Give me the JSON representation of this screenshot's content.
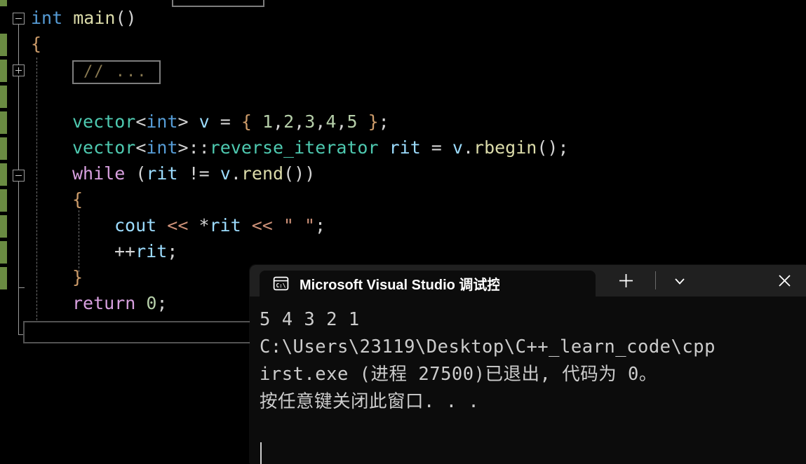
{
  "editor": {
    "name": "visual-studio-code-editor",
    "background": "#000000",
    "change_bar_color": "#6a8b42",
    "collapsed_comment_text": "// ...",
    "lines": [
      {
        "indent": 0,
        "tokens": []
      },
      {
        "indent": 0,
        "tokens": [
          {
            "t": "int",
            "c": "t-blue"
          },
          {
            "t": " ",
            "c": "t-punc"
          },
          {
            "t": "main",
            "c": "t-func"
          },
          {
            "t": "()",
            "c": "t-punc"
          }
        ]
      },
      {
        "indent": 0,
        "tokens": [
          {
            "t": "{",
            "c": "t-brace"
          }
        ]
      },
      {
        "indent": 0,
        "tokens": []
      },
      {
        "indent": 0,
        "tokens": []
      },
      {
        "indent": 0,
        "tokens": [
          {
            "t": "vector",
            "c": "t-type"
          },
          {
            "t": "<",
            "c": "t-punc"
          },
          {
            "t": "int",
            "c": "t-blue"
          },
          {
            "t": ">",
            "c": "t-punc"
          },
          {
            "t": " ",
            "c": "t-punc"
          },
          {
            "t": "v",
            "c": "t-light"
          },
          {
            "t": " = ",
            "c": "t-punc"
          },
          {
            "t": "{ ",
            "c": "t-brace"
          },
          {
            "t": "1",
            "c": "t-num"
          },
          {
            "t": ",",
            "c": "t-punc"
          },
          {
            "t": "2",
            "c": "t-num"
          },
          {
            "t": ",",
            "c": "t-punc"
          },
          {
            "t": "3",
            "c": "t-num"
          },
          {
            "t": ",",
            "c": "t-punc"
          },
          {
            "t": "4",
            "c": "t-num"
          },
          {
            "t": ",",
            "c": "t-punc"
          },
          {
            "t": "5",
            "c": "t-num"
          },
          {
            "t": " }",
            "c": "t-brace"
          },
          {
            "t": ";",
            "c": "t-punc"
          }
        ]
      },
      {
        "indent": 0,
        "tokens": [
          {
            "t": "vector",
            "c": "t-type"
          },
          {
            "t": "<",
            "c": "t-punc"
          },
          {
            "t": "int",
            "c": "t-blue"
          },
          {
            "t": ">",
            "c": "t-punc"
          },
          {
            "t": "::",
            "c": "t-punc"
          },
          {
            "t": "reverse_iterator",
            "c": "t-type"
          },
          {
            "t": " ",
            "c": "t-punc"
          },
          {
            "t": "rit",
            "c": "t-light"
          },
          {
            "t": " = ",
            "c": "t-punc"
          },
          {
            "t": "v",
            "c": "t-light"
          },
          {
            "t": ".",
            "c": "t-punc"
          },
          {
            "t": "rbegin",
            "c": "t-func"
          },
          {
            "t": "();",
            "c": "t-punc"
          }
        ]
      },
      {
        "indent": 0,
        "tokens": [
          {
            "t": "while",
            "c": "t-kw"
          },
          {
            "t": " (",
            "c": "t-punc"
          },
          {
            "t": "rit",
            "c": "t-light"
          },
          {
            "t": " != ",
            "c": "t-punc"
          },
          {
            "t": "v",
            "c": "t-light"
          },
          {
            "t": ".",
            "c": "t-punc"
          },
          {
            "t": "rend",
            "c": "t-func"
          },
          {
            "t": "())",
            "c": "t-punc"
          }
        ]
      },
      {
        "indent": 0,
        "tokens": [
          {
            "t": "{",
            "c": "t-brace"
          }
        ]
      },
      {
        "indent": 0,
        "tokens": [
          {
            "t": "cout",
            "c": "t-light"
          },
          {
            "t": " << ",
            "c": "t-str"
          },
          {
            "t": "*",
            "c": "t-punc"
          },
          {
            "t": "rit",
            "c": "t-light"
          },
          {
            "t": " << ",
            "c": "t-str"
          },
          {
            "t": "\" \"",
            "c": "t-str"
          },
          {
            "t": ";",
            "c": "t-punc"
          }
        ]
      },
      {
        "indent": 0,
        "tokens": [
          {
            "t": "++",
            "c": "t-punc"
          },
          {
            "t": "rit",
            "c": "t-light"
          },
          {
            "t": ";",
            "c": "t-punc"
          }
        ]
      },
      {
        "indent": 0,
        "tokens": [
          {
            "t": "}",
            "c": "t-brace"
          }
        ]
      },
      {
        "indent": 0,
        "tokens": [
          {
            "t": "return",
            "c": "t-kw"
          },
          {
            "t": " ",
            "c": "t-punc"
          },
          {
            "t": "0",
            "c": "t-num"
          },
          {
            "t": ";",
            "c": "t-punc"
          }
        ]
      },
      {
        "indent": 0,
        "tokens": [
          {
            "t": "}",
            "c": "t-brace"
          }
        ]
      }
    ]
  },
  "terminal": {
    "tab_title": "Microsoft Visual Studio 调试控",
    "tab_icon": "console-cmd-icon",
    "close_label": "✕",
    "newtab_label": "+",
    "dropdown_label": "⌄",
    "output": [
      "5 4 3 2 1",
      "C:\\Users\\23119\\Desktop\\C++_learn_code\\cpp",
      "irst.exe (进程 27500)已退出, 代码为 0。",
      "按任意键关闭此窗口. . ."
    ],
    "program_output_values": [
      5,
      4,
      3,
      2,
      1
    ],
    "process_id": "27500",
    "exit_code": "0"
  }
}
